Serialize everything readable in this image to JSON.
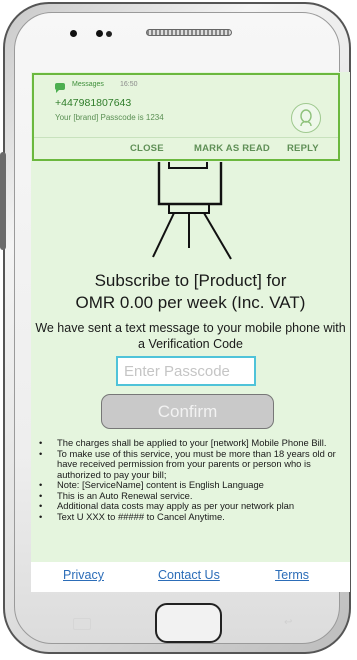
{
  "notification": {
    "app": "Messages",
    "time": "16:50",
    "sender": "+447981807643",
    "text": "Your [brand] Passcode is 1234",
    "actions": {
      "close": "CLOSE",
      "mark_as_read": "MARK AS READ",
      "reply": "REPLY"
    }
  },
  "page": {
    "title_line1": "Subscribe to [Product] for",
    "title_line2": "OMR 0.00 per week (Inc. VAT)",
    "info": "We have sent a text message to your mobile phone with a Verification Code",
    "passcode_placeholder": "Enter Passcode",
    "confirm_label": "Confirm",
    "terms": [
      "The charges shall be applied to your [network] Mobile Phone Bill.",
      "To make use of this service, you must be more than 18 years old or have received permission from your parents or person who is authorized to pay your bill;",
      "Note: [ServiceName] content is English Language",
      "This is an Auto Renewal service.",
      "Additional data costs may apply as per your network plan",
      "Text U XXX to ##### to Cancel Anytime."
    ],
    "links": {
      "privacy": "Privacy",
      "contact": "Contact Us",
      "terms": "Terms"
    }
  },
  "colors": {
    "screen_bg": "#e5f5de",
    "notification_border": "#6bb83e",
    "input_border": "#4fc3d9",
    "link": "#2c6db8",
    "confirm_bg": "#c9c9c9"
  }
}
